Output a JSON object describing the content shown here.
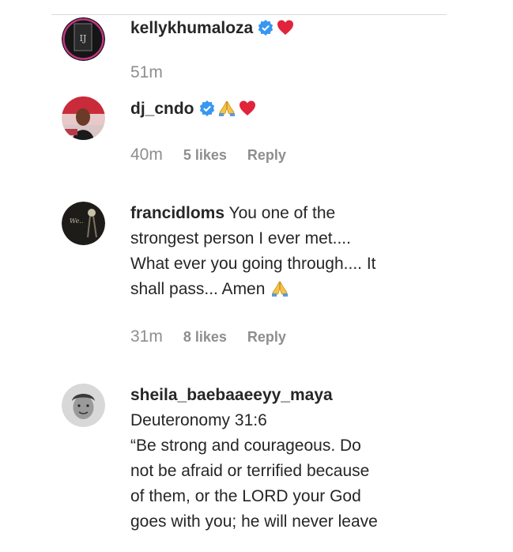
{
  "comments": [
    {
      "username": "kellykhumaloza",
      "verified": true,
      "text": "",
      "emojis": [
        "red-heart"
      ],
      "time": "51m",
      "likes": "",
      "reply_label": ""
    },
    {
      "username": "dj_cndo",
      "verified": true,
      "text": "",
      "emojis": [
        "folded-hands",
        "red-heart"
      ],
      "time": "40m",
      "likes": "5 likes",
      "reply_label": "Reply"
    },
    {
      "username": "francidloms",
      "verified": false,
      "text_lines": [
        " You one of the",
        "strongest person I ever met....",
        "What ever you going through.... It",
        "shall pass... Amen"
      ],
      "emojis": [
        "folded-hands"
      ],
      "time": "31m",
      "likes": "8 likes",
      "reply_label": "Reply"
    },
    {
      "username": "sheila_baebaaeeyy_maya",
      "verified": false,
      "text_lines": [
        "Deuteronomy 31:6",
        "“Be strong and courageous. Do",
        "not be afraid or terrified because",
        "of them, or the LORD your God",
        "goes with you; he will never leave"
      ]
    }
  ],
  "colors": {
    "text": "#262626",
    "muted": "#8e8e8e",
    "verified": "#3897f0",
    "heart": "#ed4956"
  }
}
